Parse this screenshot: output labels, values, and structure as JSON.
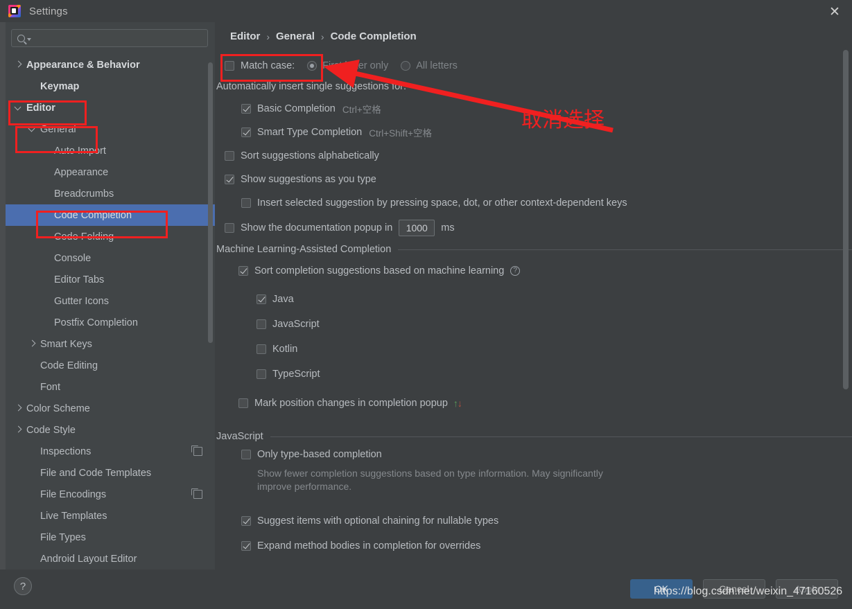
{
  "window": {
    "title": "Settings",
    "app_icon": "intellij-idea-icon",
    "close_icon": "close-icon"
  },
  "sidebar": {
    "search": {
      "value": "",
      "placeholder": "",
      "icon": "search-icon"
    },
    "items": [
      {
        "label": "Appearance & Behavior",
        "indent": 0,
        "arrow": "right",
        "bold": true,
        "selected": false,
        "badge": false
      },
      {
        "label": "Keymap",
        "indent": 1,
        "arrow": "none",
        "bold": true,
        "selected": false,
        "badge": false
      },
      {
        "label": "Editor",
        "indent": 0,
        "arrow": "down",
        "bold": true,
        "selected": false,
        "badge": false
      },
      {
        "label": "General",
        "indent": 1,
        "arrow": "down",
        "bold": false,
        "selected": false,
        "badge": false
      },
      {
        "label": "Auto Import",
        "indent": 2,
        "arrow": "none",
        "bold": false,
        "selected": false,
        "badge": false
      },
      {
        "label": "Appearance",
        "indent": 2,
        "arrow": "none",
        "bold": false,
        "selected": false,
        "badge": false
      },
      {
        "label": "Breadcrumbs",
        "indent": 2,
        "arrow": "none",
        "bold": false,
        "selected": false,
        "badge": false
      },
      {
        "label": "Code Completion",
        "indent": 2,
        "arrow": "none",
        "bold": false,
        "selected": true,
        "badge": false
      },
      {
        "label": "Code Folding",
        "indent": 2,
        "arrow": "none",
        "bold": false,
        "selected": false,
        "badge": false
      },
      {
        "label": "Console",
        "indent": 2,
        "arrow": "none",
        "bold": false,
        "selected": false,
        "badge": false
      },
      {
        "label": "Editor Tabs",
        "indent": 2,
        "arrow": "none",
        "bold": false,
        "selected": false,
        "badge": false
      },
      {
        "label": "Gutter Icons",
        "indent": 2,
        "arrow": "none",
        "bold": false,
        "selected": false,
        "badge": false
      },
      {
        "label": "Postfix Completion",
        "indent": 2,
        "arrow": "none",
        "bold": false,
        "selected": false,
        "badge": false
      },
      {
        "label": "Smart Keys",
        "indent": 1,
        "arrow": "right",
        "bold": false,
        "selected": false,
        "badge": false
      },
      {
        "label": "Code Editing",
        "indent": 1,
        "arrow": "none",
        "bold": false,
        "selected": false,
        "badge": false
      },
      {
        "label": "Font",
        "indent": 1,
        "arrow": "none",
        "bold": false,
        "selected": false,
        "badge": false
      },
      {
        "label": "Color Scheme",
        "indent": 0,
        "arrow": "right",
        "bold": false,
        "selected": false,
        "badge": false
      },
      {
        "label": "Code Style",
        "indent": 0,
        "arrow": "right",
        "bold": false,
        "selected": false,
        "badge": false
      },
      {
        "label": "Inspections",
        "indent": 1,
        "arrow": "none",
        "bold": false,
        "selected": false,
        "badge": true
      },
      {
        "label": "File and Code Templates",
        "indent": 1,
        "arrow": "none",
        "bold": false,
        "selected": false,
        "badge": false
      },
      {
        "label": "File Encodings",
        "indent": 1,
        "arrow": "none",
        "bold": false,
        "selected": false,
        "badge": true
      },
      {
        "label": "Live Templates",
        "indent": 1,
        "arrow": "none",
        "bold": false,
        "selected": false,
        "badge": false
      },
      {
        "label": "File Types",
        "indent": 1,
        "arrow": "none",
        "bold": false,
        "selected": false,
        "badge": false
      },
      {
        "label": "Android Layout Editor",
        "indent": 1,
        "arrow": "none",
        "bold": false,
        "selected": false,
        "badge": false
      }
    ]
  },
  "breadcrumb": {
    "part1": "Editor",
    "sep1": "›",
    "part2": "General",
    "sep2": "›",
    "part3": "Code Completion"
  },
  "settings": {
    "match_case_label": "Match case:",
    "match_case_checked": false,
    "first_letter_label": "First letter only",
    "first_letter_selected": true,
    "all_letters_label": "All letters",
    "all_letters_selected": false,
    "auto_insert_header": "Automatically insert single suggestions for:",
    "basic_completion_label": "Basic Completion",
    "basic_completion_shortcut": "Ctrl+空格",
    "basic_completion_checked": true,
    "smart_type_label": "Smart Type Completion",
    "smart_type_shortcut": "Ctrl+Shift+空格",
    "smart_type_checked": true,
    "sort_alpha_label": "Sort suggestions alphabetically",
    "sort_alpha_checked": false,
    "show_as_you_type_label": "Show suggestions as you type",
    "show_as_you_type_checked": true,
    "insert_selected_label": "Insert selected suggestion by pressing space, dot, or other context-dependent keys",
    "insert_selected_checked": false,
    "doc_popup_label": "Show the documentation popup in",
    "doc_popup_checked": false,
    "doc_popup_value": "1000",
    "doc_popup_unit": "ms",
    "ml_section_title": "Machine Learning-Assisted Completion",
    "ml_sort_label": "Sort completion suggestions based on machine learning",
    "ml_sort_checked": true,
    "ml_help_icon": "help-icon",
    "ml_languages": [
      {
        "label": "Java",
        "checked": true
      },
      {
        "label": "JavaScript",
        "checked": false
      },
      {
        "label": "Kotlin",
        "checked": false
      },
      {
        "label": "TypeScript",
        "checked": false
      }
    ],
    "mark_position_label": "Mark position changes in completion popup",
    "mark_position_checked": false,
    "mark_position_up": "↑",
    "mark_position_down": "↓",
    "js_section_title": "JavaScript",
    "js_only_type_label": "Only type-based completion",
    "js_only_type_checked": false,
    "js_only_type_desc": "Show fewer completion suggestions based on type information. May significantly improve performance.",
    "js_optional_chaining_label": "Suggest items with optional chaining for nullable types",
    "js_optional_chaining_checked": true,
    "js_expand_bodies_label": "Expand method bodies in completion for overrides",
    "js_expand_bodies_checked": true
  },
  "footer": {
    "help_label": "?",
    "ok_label": "OK",
    "cancel_label": "Cancel",
    "apply_label": "Apply"
  },
  "annotation": {
    "note_text": "取消选择",
    "color": "#f02020"
  },
  "watermark": {
    "text": "https://blog.csdn.net/weixin_47160526"
  }
}
